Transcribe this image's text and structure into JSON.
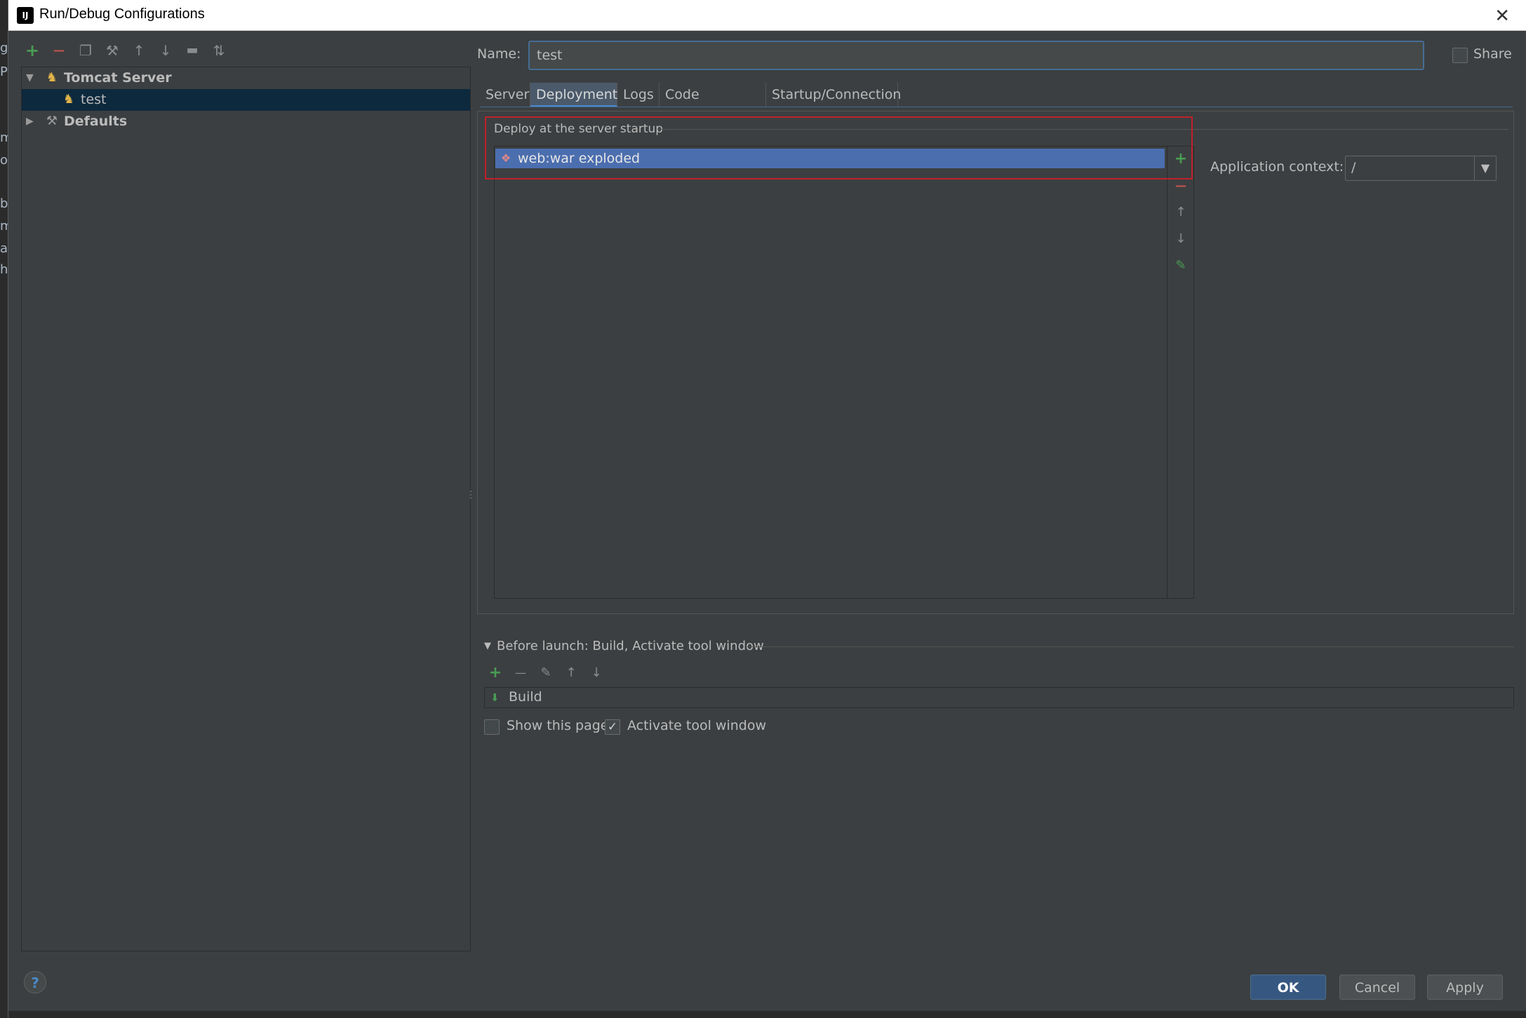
{
  "window": {
    "title": "Run/Debug Configurations"
  },
  "background_strip": [
    "gı",
    "Pa",
    "m",
    "oc",
    "b",
    "m",
    "a",
    "h"
  ],
  "left_toolbar": {
    "add": "+",
    "remove": "—",
    "copy": "❐",
    "settings": "⚒",
    "up": "↑",
    "down": "↓",
    "folder": "▬",
    "sort": "⇅"
  },
  "tree": {
    "items": [
      {
        "label": "Tomcat Server",
        "expanded": true
      },
      {
        "label": "test",
        "selected": true
      },
      {
        "label": "Defaults",
        "expanded": false
      }
    ]
  },
  "name": {
    "label": "Name:",
    "value": "test"
  },
  "share": {
    "label": "Share",
    "checked": false
  },
  "tabs": [
    {
      "label": "Server"
    },
    {
      "label": "Deployment",
      "active": true
    },
    {
      "label": "Logs"
    },
    {
      "label": "Code Coverage"
    },
    {
      "label": "Startup/Connection"
    }
  ],
  "deployment": {
    "heading": "Deploy at the server startup",
    "artifacts": [
      "web:war exploded"
    ],
    "side_buttons": {
      "add": "+",
      "remove": "—",
      "up": "↑",
      "down": "↓",
      "edit": "✎"
    },
    "application_context": {
      "label": "Application context:",
      "value": "/"
    }
  },
  "before_launch": {
    "title": "Before launch: Build, Activate tool window",
    "items": [
      "Build"
    ],
    "show_this_page": {
      "label": "Show this page",
      "checked": false
    },
    "activate_tool_window": {
      "label": "Activate tool window",
      "checked": true,
      "mark": "✓"
    }
  },
  "footer": {
    "help": "?",
    "ok": "OK",
    "cancel": "Cancel",
    "apply": "Apply"
  },
  "colors": {
    "accent": "#4a88c7",
    "selection": "#4b6eaf",
    "highlight": "#c0202a",
    "add_green": "#499c54",
    "remove_red": "#c75450"
  }
}
